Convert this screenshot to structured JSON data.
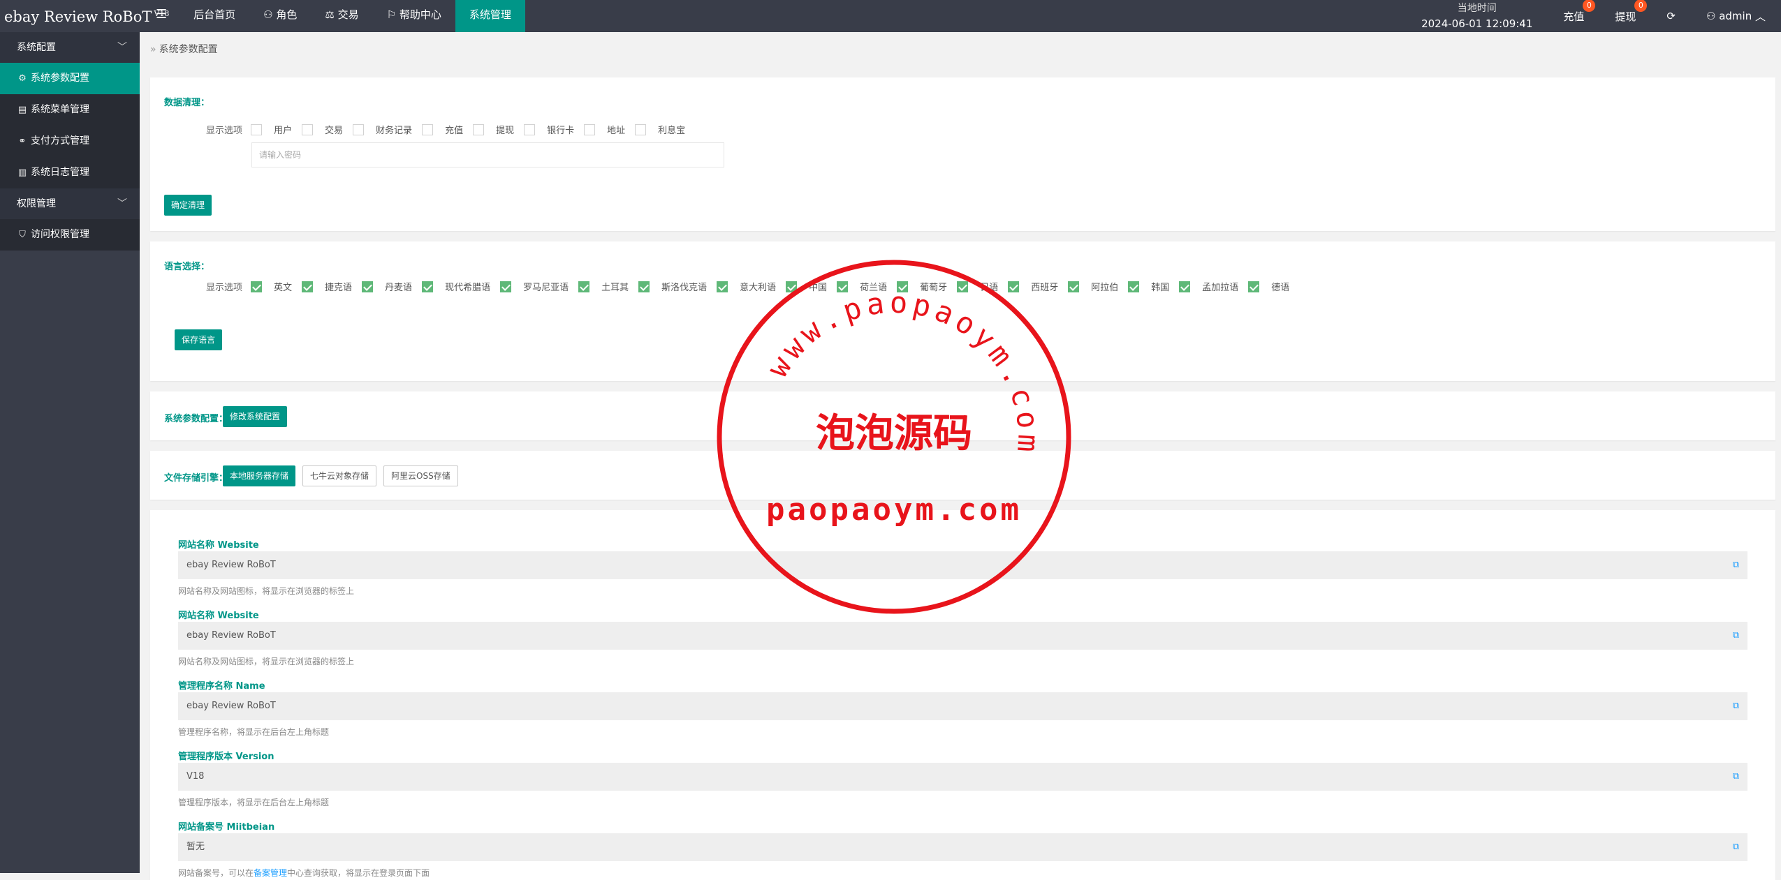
{
  "app": {
    "name": "ebay Review RoBoT",
    "version": "V18"
  },
  "topnav": {
    "menu_icon": "hamburger-icon",
    "items": [
      {
        "label": "后台首页",
        "icon": ""
      },
      {
        "label": "角色",
        "icon": "user-icon"
      },
      {
        "label": "交易",
        "icon": "scale-icon"
      },
      {
        "label": "帮助中心",
        "icon": "flag-icon"
      },
      {
        "label": "系统管理",
        "icon": "",
        "active": true
      }
    ]
  },
  "topright": {
    "clock_label": "当地时间",
    "clock_time": "2024-06-01 12:09:41",
    "recharge": {
      "label": "充值",
      "count": "0"
    },
    "withdraw": {
      "label": "提现",
      "count": "0"
    },
    "refresh_icon": "refresh-icon",
    "user": "admin"
  },
  "sidebar": {
    "groups": [
      {
        "label": "系统配置",
        "items": [
          {
            "label": "系统参数配置",
            "icon": "gear-icon",
            "active": true
          },
          {
            "label": "系统菜单管理",
            "icon": "table-icon"
          },
          {
            "label": "支付方式管理",
            "icon": "link-icon"
          },
          {
            "label": "系统日志管理",
            "icon": "log-icon"
          }
        ]
      },
      {
        "label": "权限管理",
        "items": [
          {
            "label": "访问权限管理",
            "icon": "shield-icon"
          }
        ]
      }
    ]
  },
  "breadcrumb": "系统参数配置",
  "data_clean": {
    "title": "数据清理：",
    "options_label": "显示选项",
    "options": [
      "用户",
      "交易",
      "财务记录",
      "充值",
      "提现",
      "银行卡",
      "地址",
      "利息宝"
    ],
    "password_placeholder": "请输入密码",
    "button": "确定清理"
  },
  "language": {
    "title": "语言选择：",
    "options_label": "显示选项",
    "options": [
      "英文",
      "捷克语",
      "丹麦语",
      "现代希腊语",
      "罗马尼亚语",
      "土耳其",
      "斯洛伐克语",
      "意大利语",
      "中国",
      "荷兰语",
      "葡萄牙",
      "日语",
      "西班牙",
      "阿拉伯",
      "韩国",
      "孟加拉语",
      "德语"
    ],
    "button": "保存语言"
  },
  "system_params": {
    "title": "系统参数配置：",
    "button": "修改系统配置"
  },
  "storage": {
    "title": "文件存储引擎：",
    "options": [
      "本地服务器存储",
      "七牛云对象存储",
      "阿里云OSS存储"
    ],
    "selected": "本地服务器存储"
  },
  "fields": [
    {
      "label": "网站名称 Website",
      "value": "ebay Review RoBoT",
      "help": "网站名称及网站图标，将显示在浏览器的标签上"
    },
    {
      "label": "网站名称 Website",
      "value": "ebay Review RoBoT",
      "help": "网站名称及网站图标，将显示在浏览器的标签上"
    },
    {
      "label": "管理程序名称 Name",
      "value": "ebay Review RoBoT",
      "help": "管理程序名称，将显示在后台左上角标题"
    },
    {
      "label": "管理程序版本 Version",
      "value": "V18",
      "help": "管理程序版本，将显示在后台左上角标题"
    },
    {
      "label": "网站备案号 Miitbeian",
      "value": "暂无",
      "help_before": "网站备案号，可以在",
      "help_link": "备案管理",
      "help_after": "中心查询获取，将显示在登录页面下面"
    }
  ],
  "watermark": {
    "top": "www.paopaoym.com",
    "middle": "泡泡源码",
    "bottom": "paopaoym.com",
    "color": "#e8141b"
  },
  "colors": {
    "topbar": "#393d49",
    "accent": "#009688",
    "badge": "#ff5722",
    "checkbox_checked": "#5fb878",
    "link": "#1e9fff"
  }
}
